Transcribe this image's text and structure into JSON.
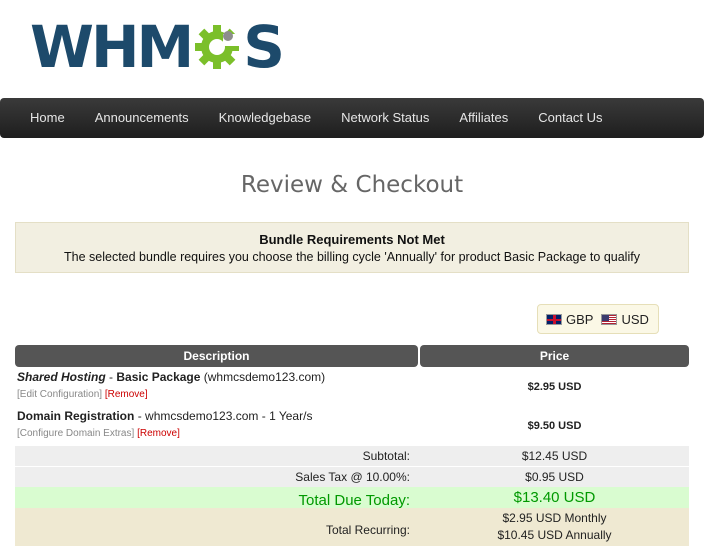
{
  "brand": {
    "logo_text_left": "WHM",
    "logo_text_right": "S"
  },
  "nav": {
    "items": [
      {
        "label": "Home"
      },
      {
        "label": "Announcements"
      },
      {
        "label": "Knowledgebase"
      },
      {
        "label": "Network Status"
      },
      {
        "label": "Affiliates"
      },
      {
        "label": "Contact Us"
      }
    ]
  },
  "page": {
    "title": "Review & Checkout"
  },
  "alert": {
    "title": "Bundle Requirements Not Met",
    "text": "The selected bundle requires you choose the billing cycle 'Annually' for product Basic Package to qualify"
  },
  "currency": {
    "options": [
      {
        "code": "GBP",
        "flag": "uk-flag-icon"
      },
      {
        "code": "USD",
        "flag": "us-flag-icon"
      }
    ]
  },
  "cart": {
    "headers": {
      "description": "Description",
      "price": "Price"
    },
    "items": [
      {
        "group": "Shared Hosting",
        "separator": " - ",
        "product": "Basic Package",
        "detail": " (whmcsdemo123.com)",
        "link_config": "[Edit Configuration]",
        "link_remove": "[Remove]",
        "price": "$2.95 USD"
      },
      {
        "product": "Domain Registration",
        "detail": " - whmcsdemo123.com - 1 Year/s",
        "link_config": "[Configure Domain Extras]",
        "link_remove": "[Remove]",
        "price": "$9.50 USD"
      }
    ],
    "subtotal": {
      "label": "Subtotal:",
      "value": "$12.45 USD"
    },
    "tax": {
      "label": "Sales Tax @ 10.00%:",
      "value": "$0.95 USD"
    },
    "total_due": {
      "label": "Total Due Today:",
      "value": "$13.40 USD"
    },
    "recurring": {
      "label": "Total Recurring:",
      "lines": [
        "$2.95 USD Monthly",
        "$10.45 USD Annually"
      ]
    }
  },
  "colors": {
    "brand_blue": "#1d4a6b",
    "brand_green": "#7bbf2a",
    "total_green": "#009900",
    "remove_red": "#cc0000"
  }
}
